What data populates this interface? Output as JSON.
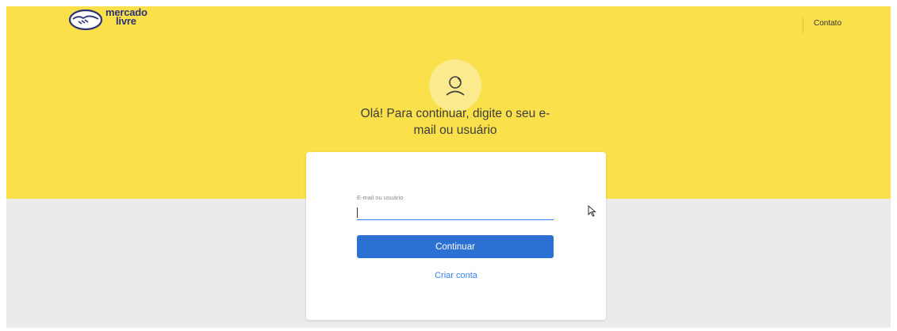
{
  "header": {
    "logo_line1": "mercado",
    "logo_line2": "livre",
    "contact_label": "Contato"
  },
  "hero": {
    "avatar_icon": "user-icon",
    "headline_line1": "Olá! Para continuar, digite o seu e-",
    "headline_line2": "mail ou usuário"
  },
  "login_form": {
    "field_label": "E-mail ou usuário",
    "field_value": "",
    "continue_label": "Continuar",
    "create_account_label": "Criar conta"
  },
  "colors": {
    "brand_yellow": "#fae04a",
    "brand_blue": "#2d3277",
    "button_blue": "#2c70d4",
    "link_blue": "#3483fa",
    "background_gray": "#ebebeb"
  }
}
